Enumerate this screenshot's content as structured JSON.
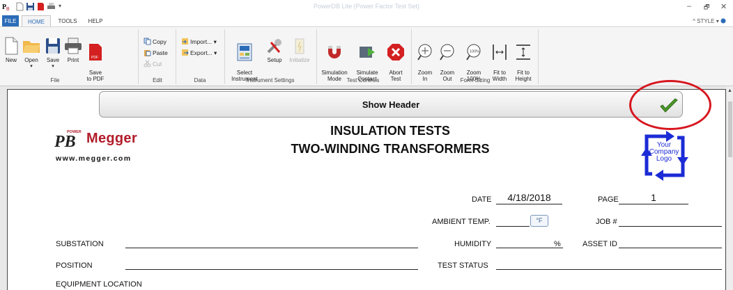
{
  "app": {
    "title": "PowerDB Lite (Power Factor Test Set)",
    "window_controls": [
      "–",
      "🗗",
      "✕"
    ]
  },
  "tabs": [
    {
      "label": "FILE"
    },
    {
      "label": "HOME"
    },
    {
      "label": "TOOLS"
    },
    {
      "label": "HELP"
    }
  ],
  "style_menu": "^ STYLE",
  "ribbon": {
    "file": {
      "group": "File",
      "new": "New",
      "open": "Open",
      "save": "Save",
      "print": "Print",
      "save_pdf": "Save\nto PDF"
    },
    "edit": {
      "group": "Edit",
      "copy": "Copy",
      "paste": "Paste",
      "cut": "Cut"
    },
    "data": {
      "group": "Data",
      "import": "Import...",
      "export": "Export..."
    },
    "instrument": {
      "group": "Instrument Settings",
      "select": "Select\nInstrument",
      "setup": "Setup",
      "initialize": "Initialize"
    },
    "test": {
      "group": "Test Controls",
      "sim_mode": "Simulation\nMode",
      "sim_contact": "Simulate\nContact",
      "abort": "Abort\nTest"
    },
    "form": {
      "group": "Form Sizing",
      "zoom_in": "Zoom\nIn",
      "zoom_out": "Zoom\nOut",
      "zoom_100": "Zoom\n100%",
      "zoom_100_icon": "100%",
      "fit_width": "Fit to\nWidth",
      "fit_height": "Fit to\nHeight"
    }
  },
  "document": {
    "show_header": "Show Header",
    "brand": {
      "logo_letters": "PB",
      "logo_small": "POWER",
      "name": "Megger",
      "url": "www.megger.com"
    },
    "title_line1": "INSULATION TESTS",
    "title_line2": "TWO-WINDING TRANSFORMERS",
    "company_logo": "Your\nCompany\nLogo",
    "fields": {
      "date_label": "DATE",
      "date_value": "4/18/2018",
      "page_label": "PAGE",
      "page_value": "1",
      "ambient_label": "AMBIENT TEMP.",
      "deg_unit": "°F",
      "job_label": "JOB #",
      "substation_label": "SUBSTATION",
      "humidity_label": "HUMIDITY",
      "humidity_unit": "%",
      "asset_label": "ASSET ID",
      "position_label": "POSITION",
      "status_label": "TEST STATUS",
      "location_label": "EQUIPMENT LOCATION"
    }
  },
  "colors": {
    "file_tab": "#2b6cb8",
    "highlight_circle": "#d7161f",
    "brand_red": "#b11c2b",
    "logo_blue": "#1b2bd6",
    "check_green": "#4c9a2a"
  }
}
